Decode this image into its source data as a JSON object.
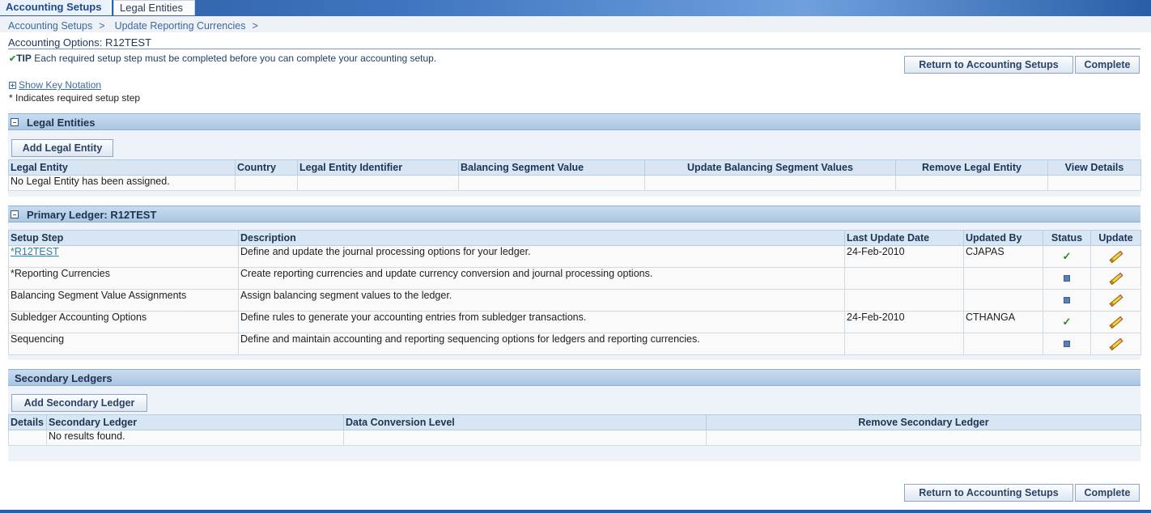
{
  "tabs": [
    {
      "label": "Accounting Setups"
    },
    {
      "label": "Legal Entities"
    }
  ],
  "breadcrumbs": [
    {
      "label": "Accounting Setups",
      "sep": ">"
    },
    {
      "label": "Update Reporting Currencies",
      "sep": ">"
    }
  ],
  "page": {
    "title_prefix": "Accounting Options: ",
    "title_value": "R12TEST",
    "tip_label": "TIP",
    "tip_text": " Each required setup step must be completed before you can complete your accounting setup.",
    "show_key_notation": "Show Key Notation",
    "required_note": "* Indicates required setup step"
  },
  "buttons": {
    "return_label": "Return to Accounting Setups",
    "complete_label": "Complete"
  },
  "legal_entities": {
    "title": "Legal Entities",
    "add_button": "Add Legal Entity",
    "columns": [
      "Legal Entity",
      "Country",
      "Legal Entity Identifier",
      "Balancing Segment Value",
      "Update Balancing Segment Values",
      "Remove Legal Entity",
      "View Details"
    ],
    "empty_message": "No Legal Entity has been assigned."
  },
  "primary_ledger": {
    "title": "Primary Ledger: R12TEST",
    "columns": [
      "Setup Step",
      "Description",
      "Last Update Date",
      "Updated By",
      "Status",
      "Update"
    ],
    "rows": [
      {
        "step": "*R12TEST",
        "description": "Define and update the journal processing options for your ledger.",
        "date": "24-Feb-2010",
        "by": "CJAPAS",
        "status": "complete"
      },
      {
        "step": "*Reporting Currencies",
        "description": "Create reporting currencies and update currency conversion and journal processing options.",
        "date": "",
        "by": "",
        "status": "not-started"
      },
      {
        "step": "Balancing Segment Value Assignments",
        "description": "Assign balancing segment values to the ledger.",
        "date": "",
        "by": "",
        "status": "not-started"
      },
      {
        "step": "Subledger Accounting Options",
        "description": "Define rules to generate your accounting entries from subledger transactions.",
        "date": "24-Feb-2010",
        "by": "CTHANGA",
        "status": "complete"
      },
      {
        "step": "Sequencing",
        "description": "Define and maintain accounting and reporting sequencing options for ledgers and reporting currencies.",
        "date": "",
        "by": "",
        "status": "not-started"
      }
    ]
  },
  "secondary_ledgers": {
    "title": "Secondary Ledgers",
    "add_button": "Add Secondary Ledger",
    "columns": [
      "Details",
      "Secondary Ledger",
      "Data Conversion Level",
      "Remove Secondary Ledger"
    ],
    "empty_message": "No results found."
  },
  "colors": {
    "header_blue": "#2a5aa0",
    "section_bg": "#c9dcef",
    "link": "#3a6aa0",
    "status_ok": "#2f8a2a",
    "status_pending": "#5a7fb5"
  }
}
